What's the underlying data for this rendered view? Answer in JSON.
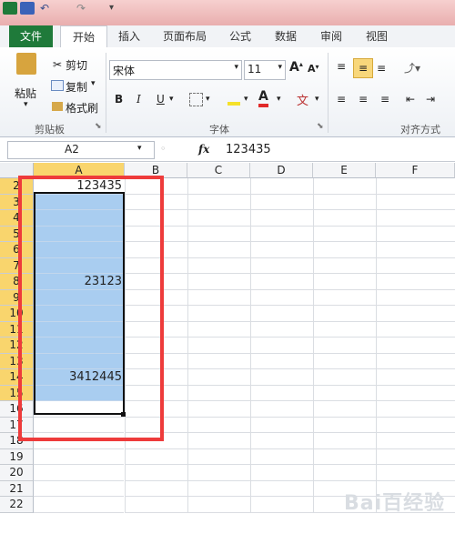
{
  "ribbon_tabs": [
    {
      "id": "file",
      "label": "文件"
    },
    {
      "id": "home",
      "label": "开始"
    },
    {
      "id": "insert",
      "label": "插入"
    },
    {
      "id": "layout",
      "label": "页面布局"
    },
    {
      "id": "formula",
      "label": "公式"
    },
    {
      "id": "data",
      "label": "数据"
    },
    {
      "id": "review",
      "label": "审阅"
    },
    {
      "id": "view",
      "label": "视图"
    }
  ],
  "clipboard": {
    "paste": "粘贴",
    "cut": "剪切",
    "copy": "复制",
    "format_painter": "格式刷",
    "group": "剪贴板"
  },
  "font": {
    "name": "宋体",
    "size": "11",
    "bold": "B",
    "italic": "I",
    "underline": "U",
    "font_color_letter": "A",
    "grow_letter": "A",
    "shrink_letter": "A",
    "group": "字体"
  },
  "alignment": {
    "group": "对齐方式"
  },
  "formula_bar": {
    "name_box": "A2",
    "fx": "fx",
    "value": "123435"
  },
  "columns": [
    "A",
    "B",
    "C",
    "D",
    "E",
    "F"
  ],
  "rows": [
    {
      "num": "2",
      "value": "123435",
      "selected": true
    },
    {
      "num": "3",
      "value": "",
      "selected": true
    },
    {
      "num": "4",
      "value": "",
      "selected": true
    },
    {
      "num": "5",
      "value": "",
      "selected": true
    },
    {
      "num": "6",
      "value": "",
      "selected": true
    },
    {
      "num": "7",
      "value": "",
      "selected": true
    },
    {
      "num": "8",
      "value": "23123",
      "selected": true
    },
    {
      "num": "9",
      "value": "",
      "selected": true
    },
    {
      "num": "10",
      "value": "",
      "selected": true
    },
    {
      "num": "11",
      "value": "",
      "selected": true
    },
    {
      "num": "12",
      "value": "",
      "selected": true
    },
    {
      "num": "13",
      "value": "",
      "selected": true
    },
    {
      "num": "14",
      "value": "3412445",
      "selected": true
    },
    {
      "num": "15",
      "value": "",
      "selected": true
    },
    {
      "num": "16",
      "value": "",
      "selected": false
    },
    {
      "num": "17",
      "value": "",
      "selected": false
    },
    {
      "num": "18",
      "value": "",
      "selected": false
    },
    {
      "num": "19",
      "value": "",
      "selected": false
    },
    {
      "num": "20",
      "value": "",
      "selected": false
    },
    {
      "num": "21",
      "value": "",
      "selected": false
    },
    {
      "num": "22",
      "value": "",
      "selected": false
    }
  ],
  "colors": {
    "selection_fill": "#a9cdf0",
    "header_highlight": "#f9d56d",
    "annotation_red": "#ee3b3b",
    "file_tab": "#1f7a3a"
  }
}
